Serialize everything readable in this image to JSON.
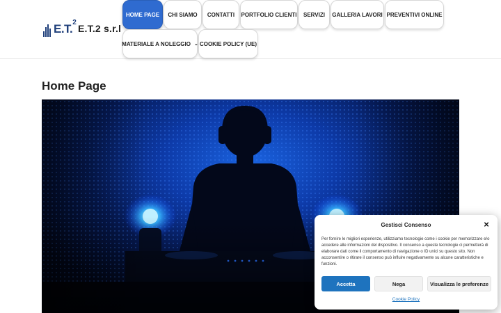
{
  "header": {
    "logo": {
      "text": "E.T.",
      "sup": "2"
    },
    "site_name": "E.T.2 s.r.l",
    "nav": [
      {
        "label": "HOME PAGE",
        "active": true
      },
      {
        "label": "CHI SIAMO"
      },
      {
        "label": "CONTATTI"
      },
      {
        "label": "PORTFOLIO CLIENTI"
      },
      {
        "label": "SERVIZI"
      },
      {
        "label": "GALLERIA LAVORI"
      },
      {
        "label": "PREVENTIVI ONLINE"
      },
      {
        "label": "MATERIALE A NOLEGGIO",
        "caret": "⌄"
      },
      {
        "label": "COOKIE POLICY (UE)"
      }
    ]
  },
  "main": {
    "title": "Home Page",
    "hero_image": "dj-silhouette-blue-lights"
  },
  "cookie_banner": {
    "title": "Gestisci Consenso",
    "close_icon": "×",
    "text": "Per fornire le migliori esperienze, utilizziamo tecnologie come i cookie per memorizzare e/o accedere alle informazioni del dispositivo. Il consenso a queste tecnologie ci permetterà di elaborare dati come il comportamento di navigazione o ID unici su questo sito. Non acconsentire o ritirare il consenso può influire negativamente su alcune caratteristiche e funzioni.",
    "accept_label": "Accetta",
    "deny_label": "Nega",
    "prefs_label": "Visualizza le preferenze",
    "policy_link": "Cookie Policy"
  },
  "colors": {
    "nav_active": "#2f6bd0",
    "accept_button": "#1e73be",
    "logo": "#1f3f7a"
  }
}
